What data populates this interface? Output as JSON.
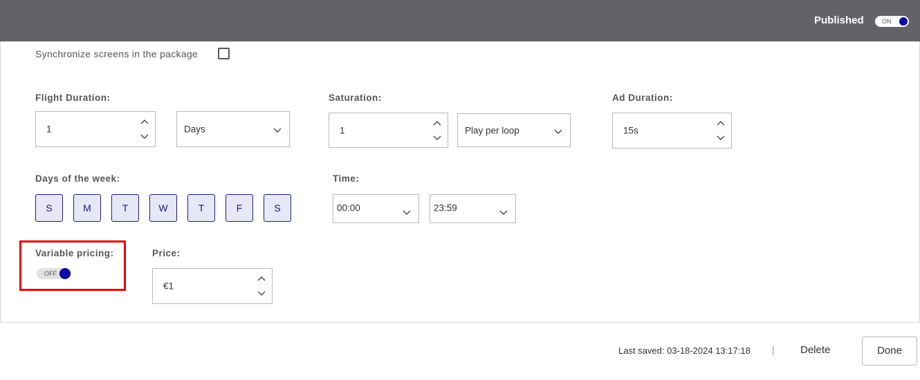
{
  "header": {
    "published_label": "Published",
    "published_toggle": "ON"
  },
  "sync": {
    "label": "Synchronize screens in the package",
    "checked": false
  },
  "flight_duration": {
    "label": "Flight Duration:",
    "value": "1",
    "unit": "Days"
  },
  "saturation": {
    "label": "Saturation:",
    "value": "1",
    "unit": "Play per loop"
  },
  "ad_duration": {
    "label": "Ad Duration:",
    "value": "15s"
  },
  "days_of_week": {
    "label": "Days of the week:",
    "days": [
      "S",
      "M",
      "T",
      "W",
      "T",
      "F",
      "S"
    ]
  },
  "time": {
    "label": "Time:",
    "start": "00:00",
    "end": "23:59"
  },
  "variable_pricing": {
    "label": "Variable pricing:",
    "toggle": "OFF"
  },
  "price": {
    "label": "Price:",
    "value": "€1"
  },
  "footer": {
    "last_saved": "Last saved: 03-18-2024 13:17:18",
    "separator": "|",
    "delete_label": "Delete",
    "done_label": "Done"
  },
  "colors": {
    "header_bg": "#636269",
    "accent": "#0a0aa5",
    "highlight": "#e80000"
  }
}
